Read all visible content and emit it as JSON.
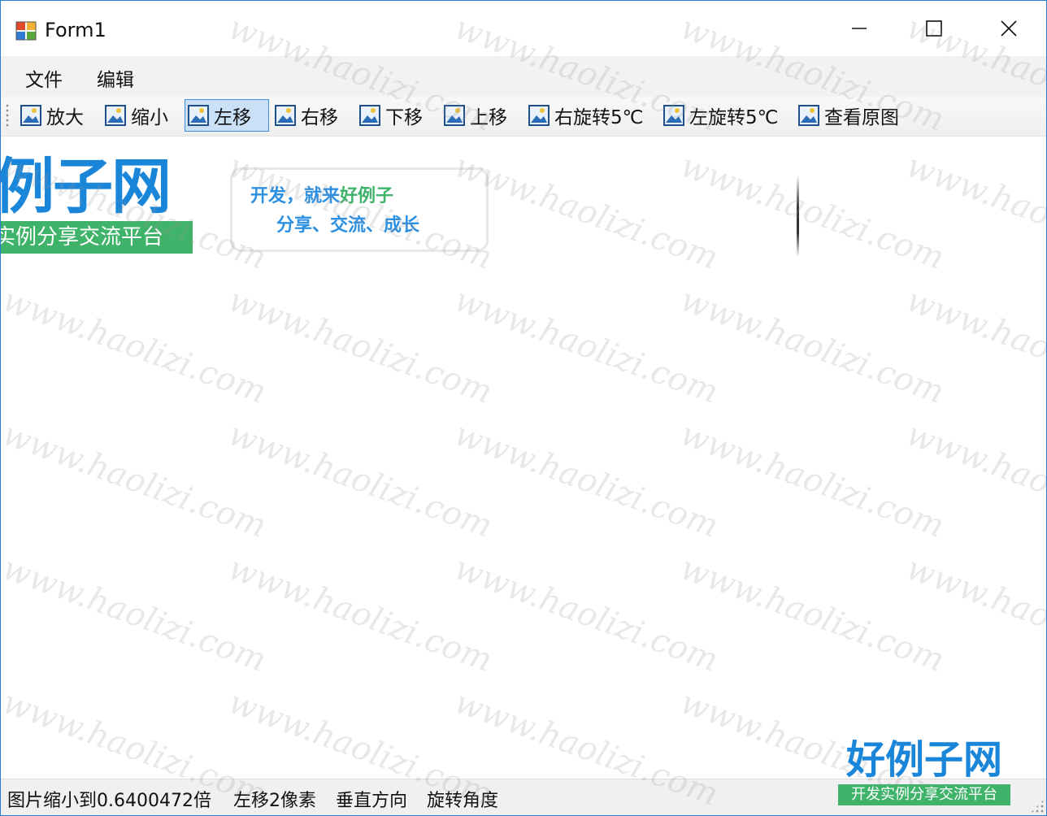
{
  "window": {
    "title": "Form1"
  },
  "menu": {
    "items": [
      {
        "label": "文件"
      },
      {
        "label": "编辑"
      }
    ]
  },
  "toolbar": {
    "buttons": [
      {
        "label": "放大"
      },
      {
        "label": "缩小"
      },
      {
        "label": "左移",
        "active": true
      },
      {
        "label": "右移"
      },
      {
        "label": "下移"
      },
      {
        "label": "上移"
      },
      {
        "label": "右旋转5℃"
      },
      {
        "label": "左旋转5℃"
      },
      {
        "label": "查看原图"
      }
    ]
  },
  "picture": {
    "logo_text": "例子网",
    "logo_band": "实例分享交流平台",
    "bubble_line1_a": "开发，就来",
    "bubble_line1_b": "好例子",
    "bubble_line2": "分享、交流、成长"
  },
  "status": {
    "zoom": "图片缩小到0.6400472倍",
    "shift": "左移2像素",
    "direction": "垂直方向",
    "rotation": "旋转角度"
  },
  "watermark": {
    "text": "www.haolizi.com"
  },
  "stamp": {
    "title": "好例子网",
    "band": "开发实例分享交流平台"
  },
  "colors": {
    "accent": "#2b7bd4",
    "logo_blue": "#1a86d9",
    "logo_green": "#3fb36a",
    "active_button": "#c9e0f7"
  }
}
